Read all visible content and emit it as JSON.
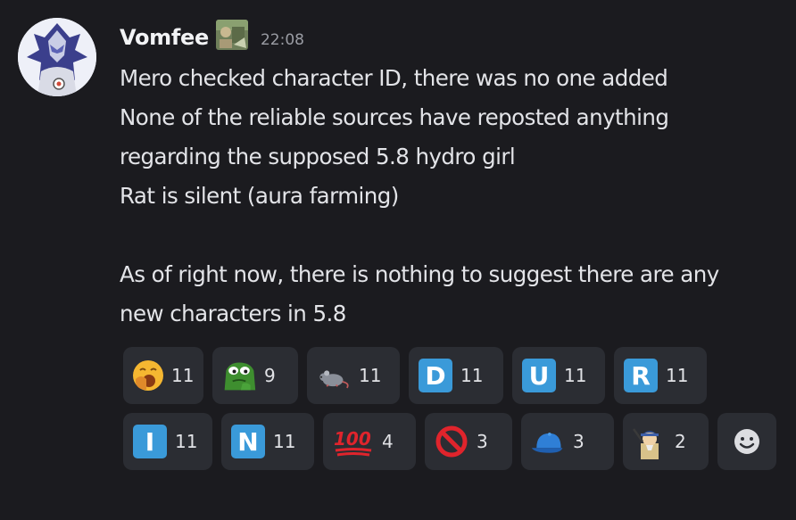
{
  "message": {
    "author": "Vomfee",
    "timestamp": "22:08",
    "lines": [
      "Mero checked character ID, there was no one added",
      "None of the reliable sources have reposted anything",
      "regarding the supposed 5.8 hydro girl",
      "Rat is silent (aura farming)",
      "",
      "As of right now, there is nothing to suggest there are any",
      "new characters in 5.8"
    ]
  },
  "reactions": [
    [
      {
        "emoji": "yawning-face",
        "count": "11"
      },
      {
        "emoji": "pepe-frog",
        "count": "9"
      },
      {
        "emoji": "rat",
        "count": "11"
      },
      {
        "emoji": "regional-indicator",
        "letter": "D",
        "count": "11"
      },
      {
        "emoji": "regional-indicator",
        "letter": "U",
        "count": "11"
      },
      {
        "emoji": "regional-indicator",
        "letter": "R",
        "count": "11"
      }
    ],
    [
      {
        "emoji": "regional-indicator",
        "letter": "I",
        "count": "11"
      },
      {
        "emoji": "regional-indicator",
        "letter": "N",
        "count": "11"
      },
      {
        "emoji": "hundred-points",
        "text": "100",
        "count": "4"
      },
      {
        "emoji": "no-entry-sign",
        "count": "3"
      },
      {
        "emoji": "blue-cap",
        "count": "3"
      },
      {
        "emoji": "custom-character",
        "count": "2"
      }
    ]
  ],
  "colors": {
    "background": "#1b1b1f",
    "reaction_bg": "#2b2d33",
    "regional_indicator": "#3a9ad9",
    "text": "#e3e4e8",
    "timestamp": "#9a9ca3"
  }
}
